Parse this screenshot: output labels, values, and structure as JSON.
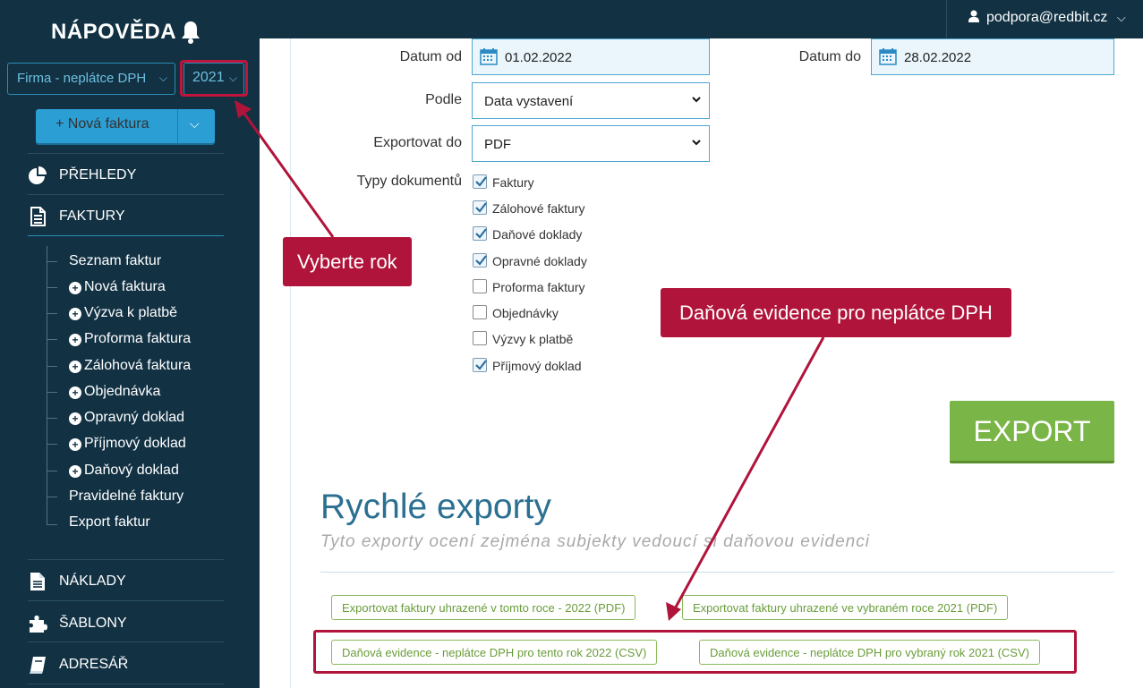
{
  "sidebar": {
    "brand": "NÁPOVĚDA",
    "company": "Firma - neplátce DPH",
    "year": "2021",
    "new_invoice_label": "+ Nová faktura",
    "nav": {
      "prehledy": "PŘEHLEDY",
      "faktury": "FAKTURY",
      "naklady": "NÁKLADY",
      "sablony": "ŠABLONY",
      "adresar": "ADRESÁŘ"
    },
    "subnav": [
      "Seznam faktur",
      "Nová faktura",
      "Výzva k platbě",
      "Proforma faktura",
      "Zálohová faktura",
      "Objednávka",
      "Opravný doklad",
      "Příjmový doklad",
      "Daňový doklad",
      "Pravidelné faktury",
      "Export faktur"
    ]
  },
  "topbar": {
    "user": "podpora@redbit.cz"
  },
  "form": {
    "date_from_label": "Datum od",
    "date_from": "01.02.2022",
    "date_to_label": "Datum do",
    "date_to": "28.02.2022",
    "by_label": "Podle",
    "by_value": "Data vystavení",
    "export_to_label": "Exportovat do",
    "export_to_value": "PDF",
    "doc_types_label": "Typy dokumentů",
    "doc_types": [
      {
        "label": "Faktury",
        "checked": true
      },
      {
        "label": "Zálohové faktury",
        "checked": true
      },
      {
        "label": "Daňové doklady",
        "checked": true
      },
      {
        "label": "Opravné doklady",
        "checked": true
      },
      {
        "label": "Proforma faktury",
        "checked": false
      },
      {
        "label": "Objednávky",
        "checked": false
      },
      {
        "label": "Výzvy k platbě",
        "checked": false
      },
      {
        "label": "Příjmový doklad",
        "checked": true
      }
    ],
    "export_button": "EXPORT"
  },
  "quick": {
    "title": "Rychlé exporty",
    "subtitle": "Tyto exporty ocení zejména subjekty vedoucí si daňovou evidenci",
    "buttons": [
      "Exportovat faktury uhrazené v tomto roce - 2022 (PDF)",
      "Exportovat faktury uhrazené ve vybraném roce 2021 (PDF)",
      "Daňová evidence - neplátce DPH pro tento rok 2022 (CSV)",
      "Daňová evidence - neplátce DPH pro vybraný rok 2021 (CSV)"
    ]
  },
  "annotations": {
    "year_callout": "Vyberte rok",
    "tax_callout": "Daňová evidence pro neplátce DPH"
  },
  "colors": {
    "sidebar_bg": "#123244",
    "accent_blue": "#2b9ed4",
    "export_green": "#7ab547",
    "annotation_red": "#b0143a"
  }
}
